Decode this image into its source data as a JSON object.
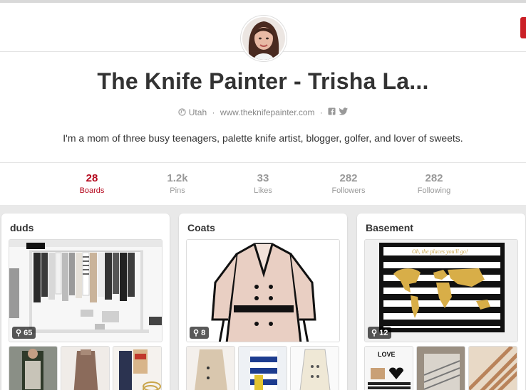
{
  "profile": {
    "name": "The Knife Painter - Trisha La...",
    "location": "Utah",
    "website": "www.theknifepainter.com",
    "bio": "I'm a mom of three busy teenagers, palette knife artist, blogger, golfer, and lover of sweets."
  },
  "stats": [
    {
      "num": "28",
      "label": "Boards"
    },
    {
      "num": "1.2k",
      "label": "Pins"
    },
    {
      "num": "33",
      "label": "Likes"
    },
    {
      "num": "282",
      "label": "Followers"
    },
    {
      "num": "282",
      "label": "Following"
    }
  ],
  "boards": [
    {
      "title": "duds",
      "count": "65"
    },
    {
      "title": "Coats",
      "count": "8"
    },
    {
      "title": "Basement",
      "count": "12"
    }
  ],
  "art_text": {
    "map_script": "Oh, the places you'll go!",
    "love": "LOVE"
  },
  "colors": {
    "accent": "#b5071d",
    "brand_red": "#cb2027"
  },
  "icons": {
    "location": "globe-icon",
    "facebook": "facebook-icon",
    "twitter": "twitter-icon",
    "pin": "pin-icon"
  }
}
